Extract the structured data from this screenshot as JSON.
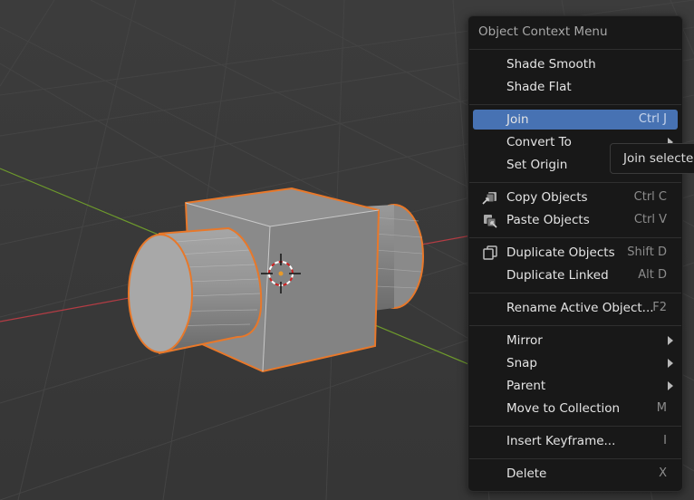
{
  "menu": {
    "title": "Object Context Menu",
    "items": [
      {
        "label": "Shade Smooth",
        "shortcut": ""
      },
      {
        "label": "Shade Flat",
        "shortcut": ""
      },
      {
        "label": "Join",
        "shortcut": "Ctrl J",
        "active": true
      },
      {
        "label": "Convert To",
        "shortcut": "",
        "submenu": true
      },
      {
        "label": "Set Origin",
        "shortcut": "",
        "submenu": true
      },
      {
        "label": "Copy Objects",
        "shortcut": "Ctrl C",
        "icon": "copy-objects-icon"
      },
      {
        "label": "Paste Objects",
        "shortcut": "Ctrl V",
        "icon": "paste-objects-icon"
      },
      {
        "label": "Duplicate Objects",
        "shortcut": "Shift D",
        "icon": "duplicate-icon"
      },
      {
        "label": "Duplicate Linked",
        "shortcut": "Alt D"
      },
      {
        "label": "Rename Active Object...",
        "shortcut": "F2"
      },
      {
        "label": "Mirror",
        "shortcut": "",
        "submenu": true
      },
      {
        "label": "Snap",
        "shortcut": "",
        "submenu": true
      },
      {
        "label": "Parent",
        "shortcut": "",
        "submenu": true
      },
      {
        "label": "Move to Collection",
        "shortcut": "M"
      },
      {
        "label": "Insert Keyframe...",
        "shortcut": "I"
      },
      {
        "label": "Delete",
        "shortcut": "X"
      }
    ]
  },
  "tooltip": {
    "text": "Join selected"
  },
  "colors": {
    "background": "#3a3a3a",
    "menu_bg": "#181818",
    "highlight": "#4772b3",
    "selection_outline": "#e8782a",
    "axis_x": "#b43c44",
    "axis_y": "#6e9a2c"
  }
}
